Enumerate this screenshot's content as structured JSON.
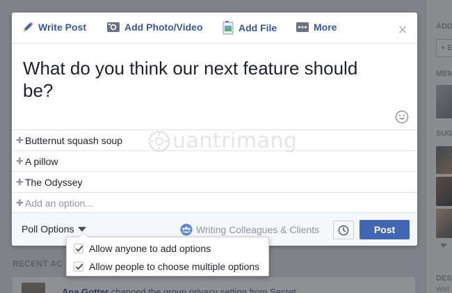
{
  "tabs": {
    "write_post": "Write Post",
    "add_photo_video": "Add Photo/Video",
    "add_file": "Add File",
    "more": "More"
  },
  "composer": {
    "question": "What do you think our next feature should be?",
    "options": [
      "Butternut squash soup",
      "A pillow",
      "The Odyssey"
    ],
    "add_option_placeholder": "Add an option..."
  },
  "footer": {
    "poll_options_label": "Poll Options",
    "audience_label": "Writing Colleagues & Clients",
    "post_label": "Post"
  },
  "poll_menu": {
    "items": [
      {
        "label": "Allow anyone to add options",
        "checked": true
      },
      {
        "label": "Allow people to choose multiple options",
        "checked": true
      }
    ]
  },
  "background": {
    "recent_activity_label": "RECENT AC",
    "activity_name": "Ana Gotter",
    "activity_text": " changed the group privacy setting from Secret",
    "right_labels": [
      "ADD",
      "MEM",
      "SUG",
      "DES"
    ],
    "right_button": "+ E",
    "right_footer": "Wel"
  },
  "watermark": "uantrimang",
  "colors": {
    "brand_blue": "#4267b2",
    "link_blue": "#365899",
    "overlay": "#7f8286"
  }
}
